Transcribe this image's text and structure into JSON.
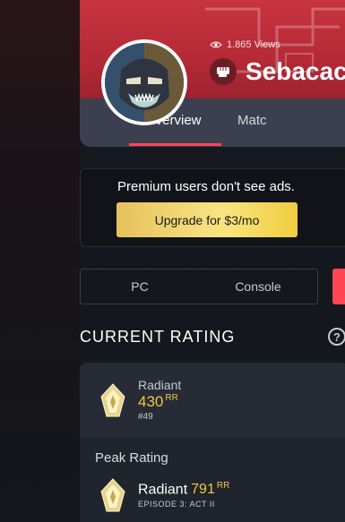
{
  "profile": {
    "views": "1.865 Views",
    "player_name": "Sebacac",
    "tabs": [
      {
        "label": "Overview"
      },
      {
        "label": "Matc"
      }
    ]
  },
  "ads": {
    "message": "Premium users don't see ads.",
    "upgrade_label": "Upgrade for $3/mo"
  },
  "platform": {
    "options": [
      {
        "label": "PC"
      },
      {
        "label": "Console"
      }
    ]
  },
  "current_rating": {
    "section_title": "CURRENT RATING",
    "help_icon": "?",
    "rank": "Radiant",
    "rr": "430",
    "rr_unit": "RR",
    "leaderboard": "#49"
  },
  "peak_rating": {
    "title": "Peak Rating",
    "rank": "Radiant",
    "rr": "791",
    "rr_unit": "RR",
    "episode": "EPISODE 3: ACT II"
  },
  "colors": {
    "accent": "#ff4655",
    "gold": "#f0c945",
    "banner": "#c8343f"
  },
  "icons": {
    "views": "eye-icon",
    "player": "fist-icon",
    "help": "help-icon",
    "rank": "radiant-rank-icon"
  }
}
